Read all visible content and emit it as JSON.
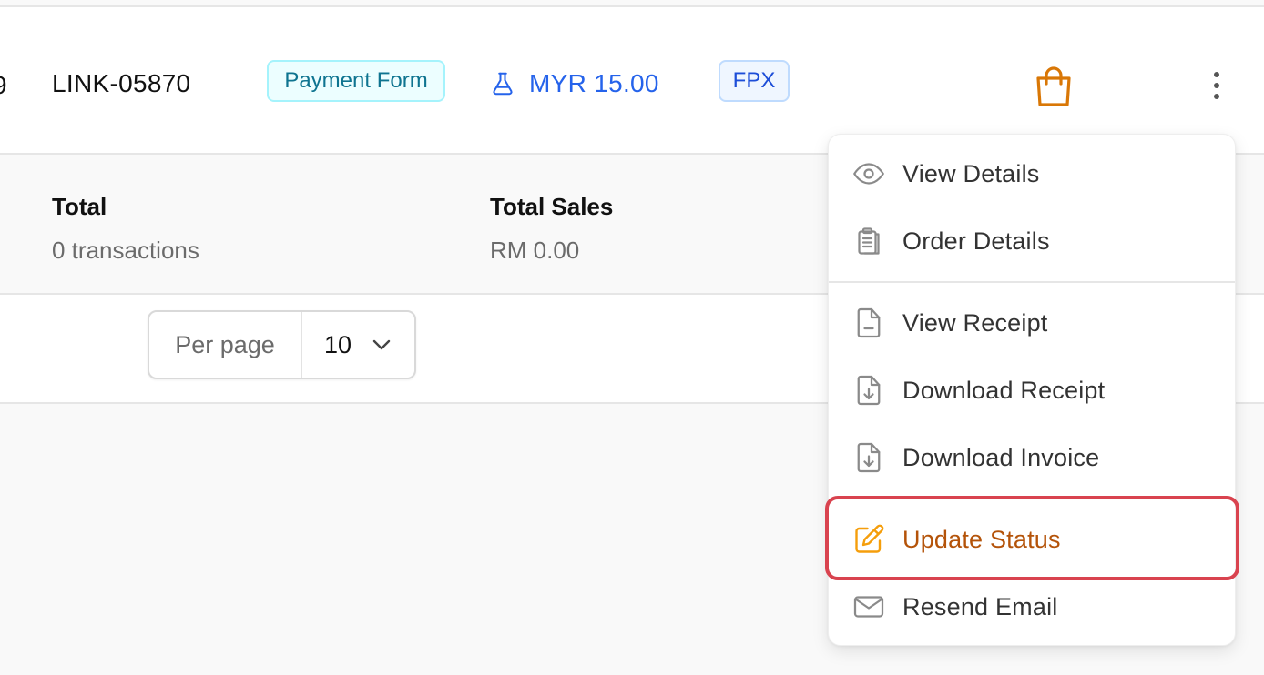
{
  "row": {
    "partial_id": "9",
    "link_id": "LINK-05870",
    "type_badge": "Payment Form",
    "amount": "MYR 15.00",
    "method_badge": "FPX",
    "colors": {
      "type": "#0e7490",
      "amount": "#2563eb",
      "method": "#1d4ed8",
      "bag": "#d97706"
    }
  },
  "summary": {
    "total_label": "Total",
    "total_value": "0 transactions",
    "sales_label": "Total Sales",
    "sales_value": "RM 0.00"
  },
  "pagination": {
    "per_page_label": "Per page",
    "per_page_value": "10"
  },
  "menu": {
    "items": [
      {
        "label": "View Details",
        "icon": "eye-icon"
      },
      {
        "label": "Order Details",
        "icon": "clipboard-list-icon"
      },
      {
        "label": "View Receipt",
        "icon": "file-text-icon"
      },
      {
        "label": "Download Receipt",
        "icon": "file-download-icon"
      },
      {
        "label": "Download Invoice",
        "icon": "file-download-icon"
      },
      {
        "label": "Update Status",
        "icon": "pencil-square-icon",
        "highlighted": true
      },
      {
        "label": "Resend Email",
        "icon": "envelope-icon"
      }
    ],
    "highlight_color": "#d9434f"
  }
}
